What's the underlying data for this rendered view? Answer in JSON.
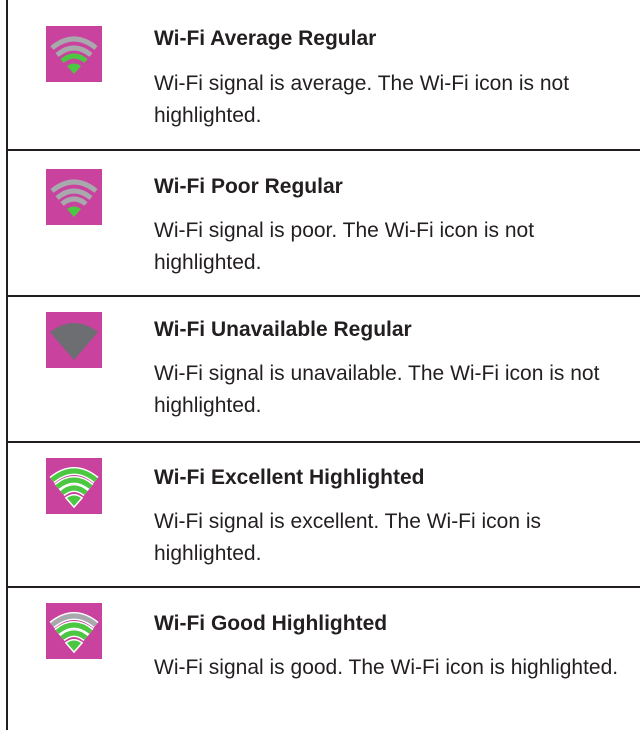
{
  "colors": {
    "icon_background": "#c8429e",
    "signal_grey": "#a7a9ac",
    "signal_dark_grey": "#6d6e71",
    "signal_green": "#4cc742",
    "signal_outline_white": "#ffffff",
    "rule": "#231f20"
  },
  "rows": [
    {
      "icon": "wifi-average-regular-icon",
      "title": "Wi-Fi Average Regular",
      "description": "Wi-Fi signal is average. The Wi-Fi icon is not highlighted."
    },
    {
      "icon": "wifi-poor-regular-icon",
      "title": "Wi-Fi Poor Regular",
      "description": "Wi-Fi signal is poor. The Wi-Fi icon is not highlighted."
    },
    {
      "icon": "wifi-unavailable-regular-icon",
      "title": "Wi-Fi Unavailable Regular",
      "description": "Wi-Fi signal is unavailable. The Wi-Fi icon is not highlighted."
    },
    {
      "icon": "wifi-excellent-highlighted-icon",
      "title": "Wi-Fi Excellent Highlighted",
      "description": "Wi-Fi signal is excellent. The Wi-Fi icon is highlighted."
    },
    {
      "icon": "wifi-good-highlighted-icon",
      "title": "Wi-Fi Good Highlighted",
      "description": "Wi-Fi signal is good. The Wi-Fi icon is highlighted."
    }
  ]
}
